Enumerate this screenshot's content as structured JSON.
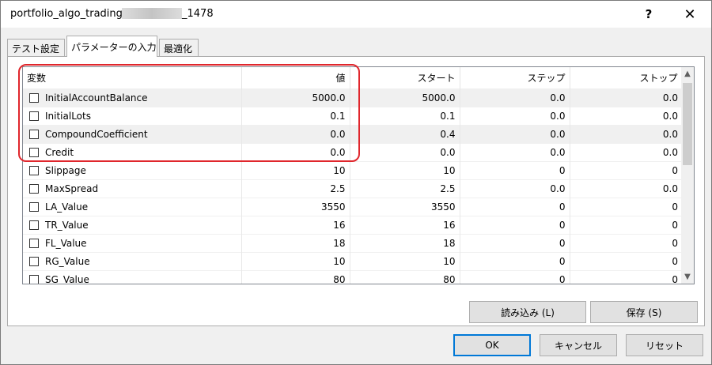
{
  "window": {
    "title_prefix": "portfolio_algo_trading_",
    "title_suffix": "_1478",
    "help_label": "?",
    "close_label": "✕"
  },
  "tabs": [
    {
      "label": "テスト設定"
    },
    {
      "label": "パラメーターの入力"
    },
    {
      "label": "最適化"
    }
  ],
  "table": {
    "headers": [
      "変数",
      "値",
      "スタート",
      "ステップ",
      "ストップ"
    ],
    "rows": [
      {
        "name": "InitialAccountBalance",
        "value": "5000.0",
        "start": "5000.0",
        "step": "0.0",
        "stop": "0.0"
      },
      {
        "name": "InitialLots",
        "value": "0.1",
        "start": "0.1",
        "step": "0.0",
        "stop": "0.0"
      },
      {
        "name": "CompoundCoefficient",
        "value": "0.0",
        "start": "0.4",
        "step": "0.0",
        "stop": "0.0"
      },
      {
        "name": "Credit",
        "value": "0.0",
        "start": "0.0",
        "step": "0.0",
        "stop": "0.0"
      },
      {
        "name": "Slippage",
        "value": "10",
        "start": "10",
        "step": "0",
        "stop": "0"
      },
      {
        "name": "MaxSpread",
        "value": "2.5",
        "start": "2.5",
        "step": "0.0",
        "stop": "0.0"
      },
      {
        "name": "LA_Value",
        "value": "3550",
        "start": "3550",
        "step": "0",
        "stop": "0"
      },
      {
        "name": "TR_Value",
        "value": "16",
        "start": "16",
        "step": "0",
        "stop": "0"
      },
      {
        "name": "FL_Value",
        "value": "18",
        "start": "18",
        "step": "0",
        "stop": "0"
      },
      {
        "name": "RG_Value",
        "value": "10",
        "start": "10",
        "step": "0",
        "stop": "0"
      },
      {
        "name": "SG_Value",
        "value": "80",
        "start": "80",
        "step": "0",
        "stop": "0"
      }
    ]
  },
  "buttons": {
    "load": "読み込み (L)",
    "save": "保存 (S)",
    "ok": "OK",
    "cancel": "キャンセル",
    "reset": "リセット"
  },
  "colors": {
    "highlight": "#e0262c",
    "default_button_border": "#0078d7"
  }
}
